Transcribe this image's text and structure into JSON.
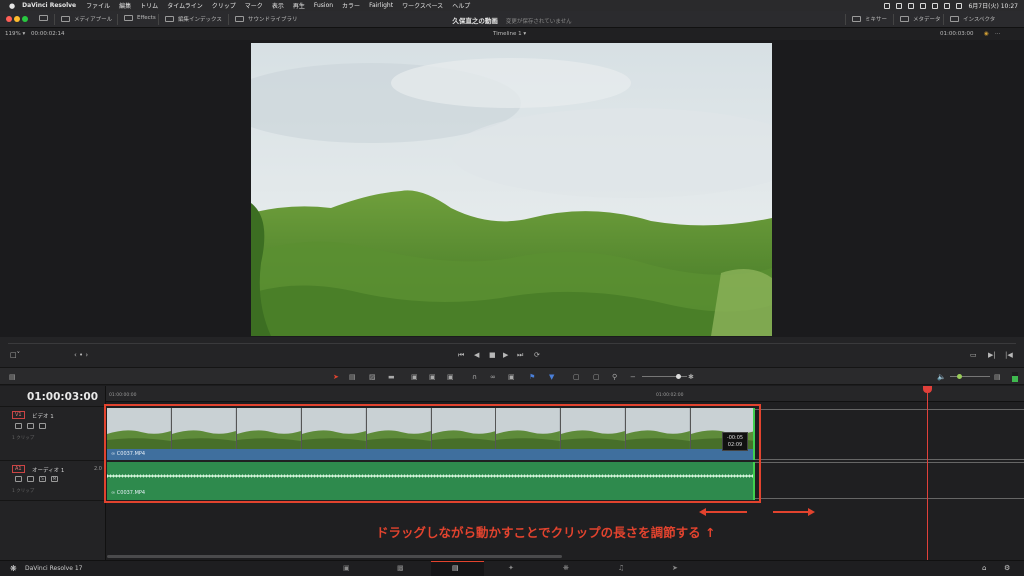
{
  "menubar": {
    "apple": "",
    "app": "DaVinci Resolve",
    "items": [
      "ファイル",
      "編集",
      "トリム",
      "タイムライン",
      "クリップ",
      "マーク",
      "表示",
      "再生",
      "Fusion",
      "カラー",
      "Fairlight",
      "ワークスペース",
      "ヘルプ"
    ],
    "clock": "6月7日(火) 10:27"
  },
  "toolbar": {
    "media_pool": "メディアプール",
    "effects": "Effects",
    "edit_index": "編集インデックス",
    "sound_library": "サウンドライブラリ",
    "project_title": "久保直之の動画",
    "save_status": "変更が保存されていません",
    "mixer": "ミキサー",
    "metadata": "メタデータ",
    "inspector": "インスペクタ"
  },
  "viewer": {
    "zoom": "119%",
    "source_tc": "00:00:02:14",
    "timeline_name": "Timeline 1",
    "record_tc": "01:00:03:00"
  },
  "timeline": {
    "timecode": "01:00:03:00",
    "ruler": [
      "01:00:00:00",
      "01:00:02:00"
    ],
    "video_track": {
      "id": "V1",
      "name": "ビデオ 1",
      "sub": "1 クリップ"
    },
    "audio_track": {
      "id": "A1",
      "name": "オーディオ 1",
      "sub": "1 クリップ",
      "channels": "2.0"
    },
    "video_clip": "C0037.MP4",
    "audio_clip": "C0037.MP4",
    "trim_delta": "-00:05",
    "trim_duration": "02:09",
    "annotation": "ドラッグしながら動かすことでクリップの長さを調節する ↑"
  },
  "pagebar": {
    "brand": "DaVinci Resolve 17"
  },
  "colors": {
    "accent": "#e2432e",
    "video_clip": "#3f6f9e",
    "audio_clip": "#2e8a4d"
  }
}
